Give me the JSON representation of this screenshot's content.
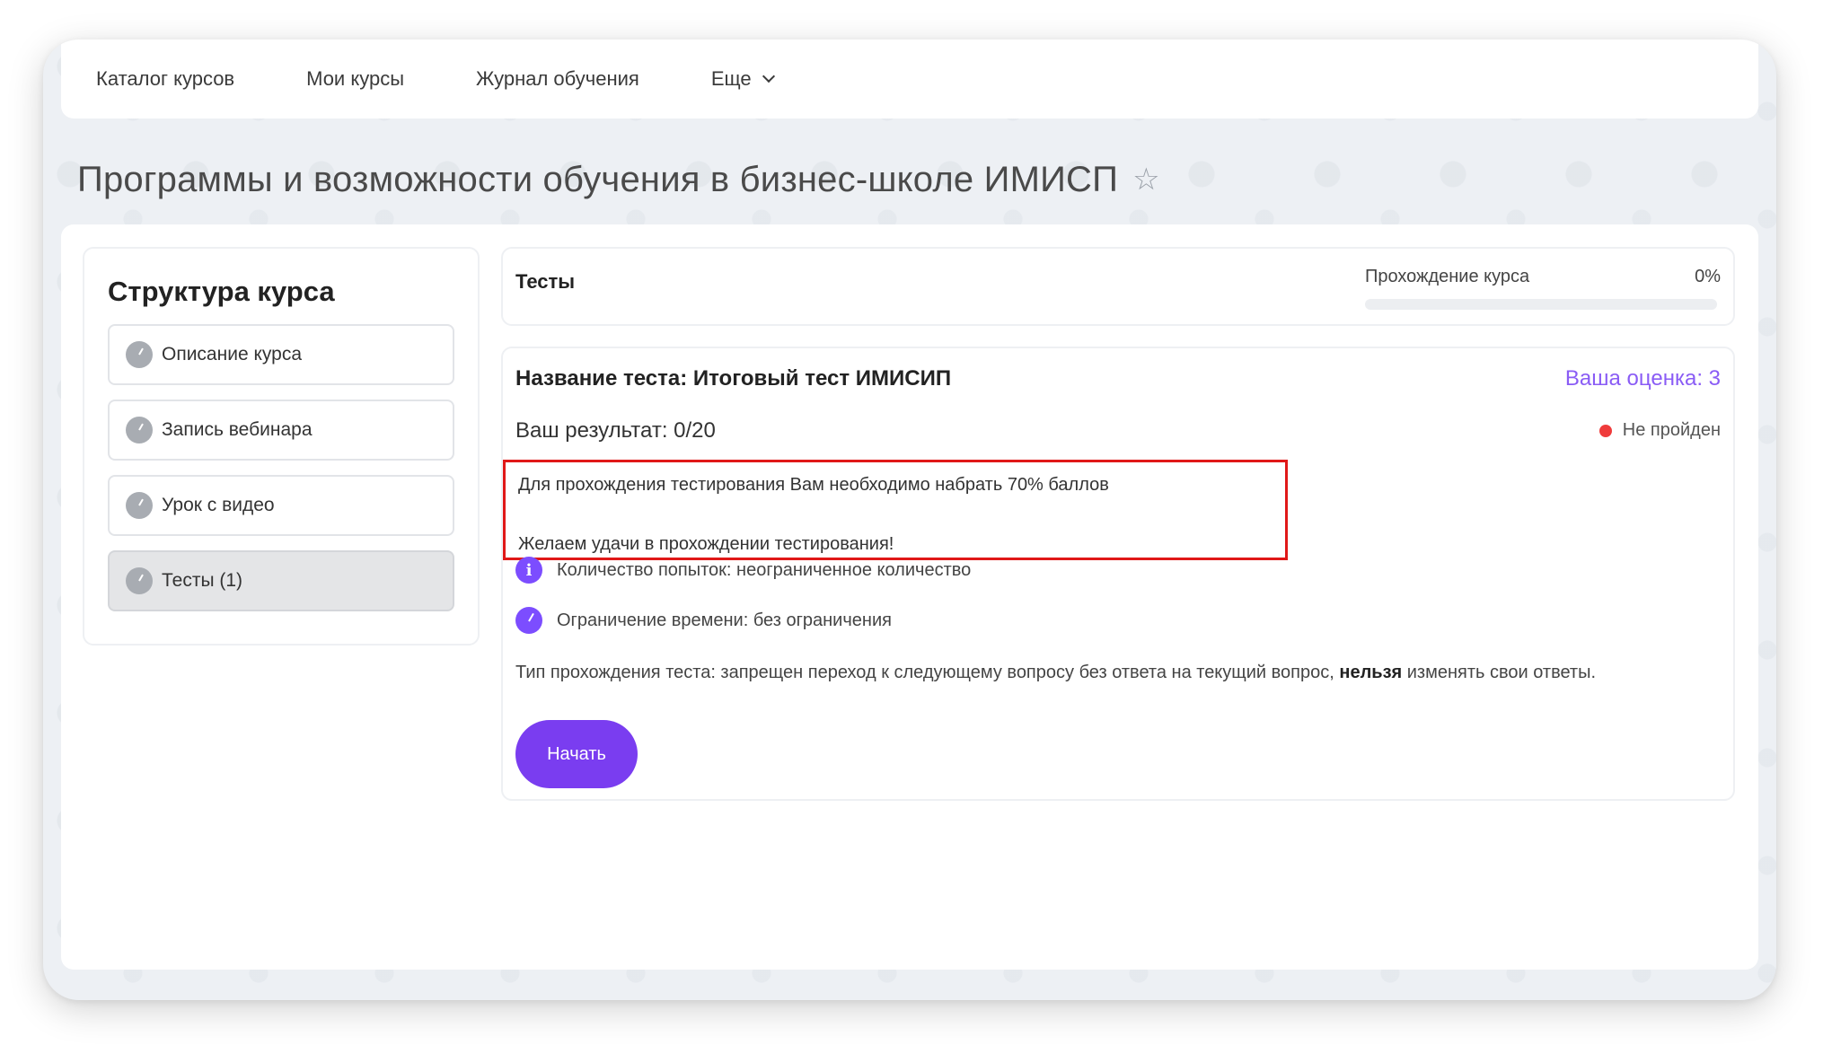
{
  "nav": {
    "items": [
      {
        "label": "Каталог курсов"
      },
      {
        "label": "Мои курсы"
      },
      {
        "label": "Журнал обучения"
      },
      {
        "label": "Еще"
      }
    ]
  },
  "page": {
    "title": "Программы и возможности обучения в бизнес-школе ИМИСП",
    "favorite_icon": "star-icon"
  },
  "sidebar": {
    "title": "Структура курса",
    "items": [
      {
        "label": "Описание курса",
        "icon": "clock-icon",
        "active": false
      },
      {
        "label": "Запись вебинара",
        "icon": "clock-icon",
        "active": false
      },
      {
        "label": "Урок с видео",
        "icon": "clock-icon",
        "active": false
      },
      {
        "label": "Тесты (1)",
        "icon": "clock-icon",
        "active": true
      }
    ]
  },
  "header": {
    "section_title": "Тесты",
    "progress_label": "Прохождение курса",
    "progress_value": "0%",
    "progress_fraction": 0
  },
  "test": {
    "name": "Название теста: Итоговый тест ИМИСИП",
    "grade": "Ваша оценка: 3",
    "result": "Ваш результат: 0/20",
    "status": "Не пройден",
    "status_color": "#ef3b3b",
    "note_line1": "Для прохождения тестирования Вам необходимо набрать 70% баллов",
    "note_line2": "Желаем удачи в прохождении тестирования!",
    "attempts": "Количество попыток: неограниченное количество",
    "time_limit": "Ограничение времени: без ограничения",
    "pass_type_prefix": "Тип прохождения теста: запрещен переход к следующему вопросу без ответа на текущий вопрос, ",
    "pass_type_bold": "нельзя",
    "pass_type_suffix": " изменять свои ответы.",
    "start_label": "Начать"
  },
  "colors": {
    "accent": "#7a3df0",
    "grade_text": "#8a5cf5",
    "highlight_box": "#e01818"
  }
}
